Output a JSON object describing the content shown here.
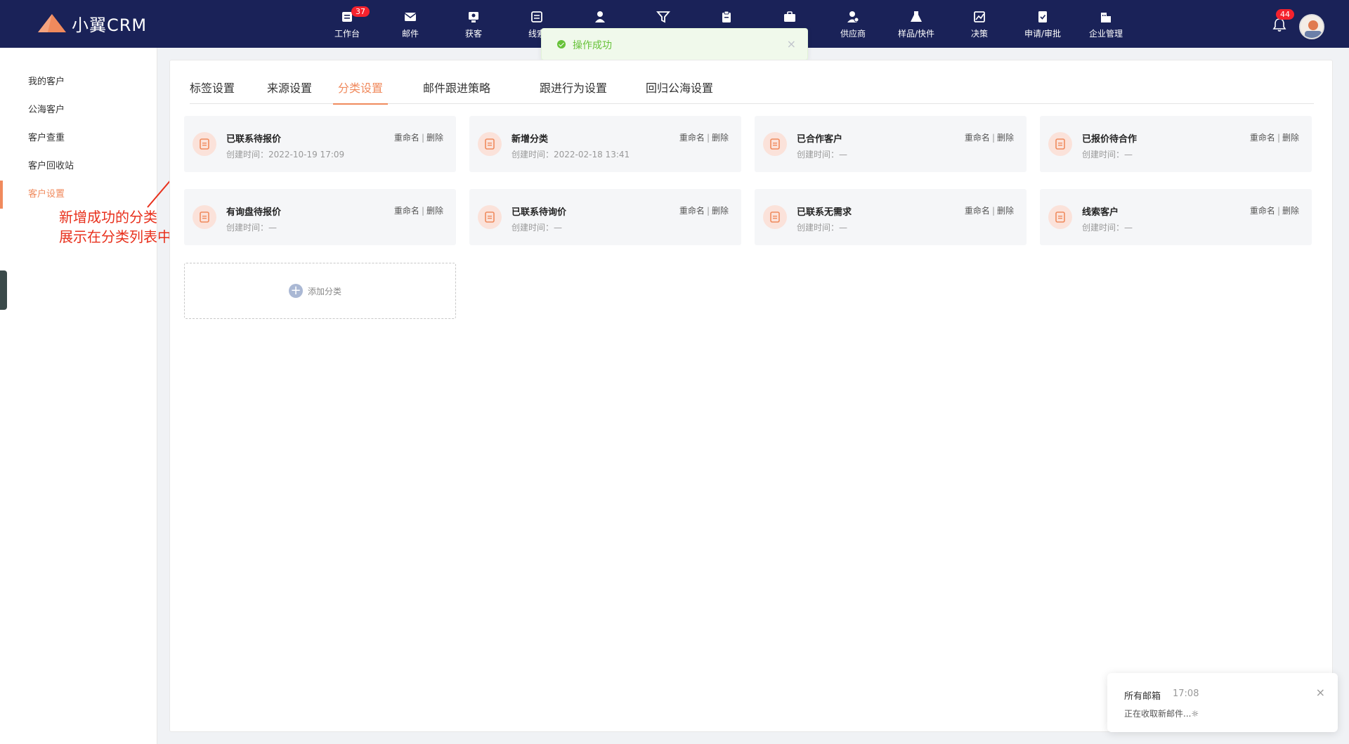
{
  "app": {
    "logo_text": "小翼CRM"
  },
  "nav": {
    "items": [
      {
        "label": "工作台",
        "icon": "workbench-icon",
        "badge": "37"
      },
      {
        "label": "邮件",
        "icon": "mail-icon"
      },
      {
        "label": "获客",
        "icon": "acquire-icon"
      },
      {
        "label": "线索",
        "icon": "lead-icon"
      },
      {
        "label": "",
        "icon": "customer-icon"
      },
      {
        "label": "",
        "icon": "funnel-icon"
      },
      {
        "label": "",
        "icon": "clipboard-icon"
      },
      {
        "label": "",
        "icon": "briefcase-icon"
      },
      {
        "label": "供应商",
        "icon": "supplier-icon"
      },
      {
        "label": "样品/快件",
        "icon": "flask-icon"
      },
      {
        "label": "决策",
        "icon": "chart-icon"
      },
      {
        "label": "申请/审批",
        "icon": "approval-icon"
      },
      {
        "label": "企业管理",
        "icon": "building-icon"
      }
    ],
    "bell_badge": "44"
  },
  "toast": {
    "text": "操作成功",
    "close": "×"
  },
  "sidebar": {
    "items": [
      {
        "label": "我的客户"
      },
      {
        "label": "公海客户"
      },
      {
        "label": "客户查重"
      },
      {
        "label": "客户回收站"
      },
      {
        "label": "客户设置"
      }
    ],
    "active_index": 4
  },
  "annotation": {
    "line1": "新增成功的分类",
    "line2": "展示在分类列表中"
  },
  "tabs": [
    {
      "label": "标签设置"
    },
    {
      "label": "来源设置"
    },
    {
      "label": "分类设置"
    },
    {
      "label": "邮件跟进策略"
    },
    {
      "label": "跟进行为设置"
    },
    {
      "label": "回归公海设置"
    }
  ],
  "active_tab": 2,
  "categories": [
    {
      "title": "已联系待报价",
      "time_label": "创建时间：2022-10-19 17:09"
    },
    {
      "title": "新增分类",
      "time_label": "创建时间：2022-02-18 13:41"
    },
    {
      "title": "已合作客户",
      "time_label": "创建时间：—"
    },
    {
      "title": "已报价待合作",
      "time_label": "创建时间：—"
    },
    {
      "title": "有询盘待报价",
      "time_label": "创建时间：—"
    },
    {
      "title": "已联系待询价",
      "time_label": "创建时间：—"
    },
    {
      "title": "已联系无需求",
      "time_label": "创建时间：—"
    },
    {
      "title": "线索客户",
      "time_label": "创建时间：—"
    }
  ],
  "card_actions": {
    "rename": "重命名",
    "separator": "|",
    "delete": "删除"
  },
  "add_category": {
    "plus": "+",
    "label": "添加分类"
  },
  "notice": {
    "title": "所有邮箱",
    "time": "17:08",
    "body": "正在收取新邮件...☼",
    "close": "×"
  },
  "colors": {
    "nav_bg": "#1a2258",
    "accent": "#f08a5d",
    "success": "#67c23a",
    "annotation": "#e8301c"
  }
}
